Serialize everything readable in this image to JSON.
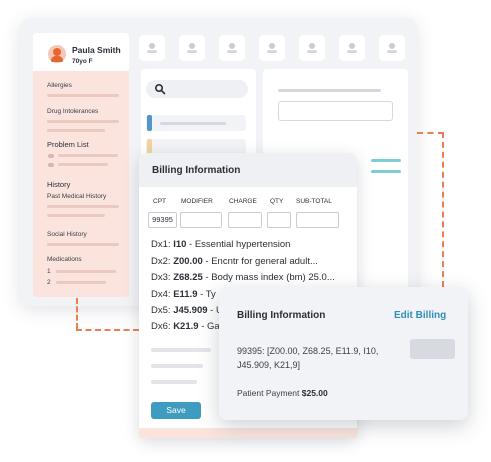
{
  "patient": {
    "name": "Paula Smith",
    "meta": "70yo F"
  },
  "sidebar": {
    "sections": [
      "Allergies",
      "Drug Intolerances",
      "Problem List",
      "History",
      "Past Medical History",
      "Social History",
      "Medications"
    ],
    "medication_numbers": [
      "1",
      "2"
    ]
  },
  "billing_form": {
    "title": "Billing Information",
    "columns": [
      "CPT",
      "MODIFIER",
      "CHARGE",
      "QTY",
      "SUB-TOTAL"
    ],
    "cpt_value": "99395",
    "diagnoses": [
      {
        "prefix": "Dx1:",
        "code": "I10",
        "desc": "- Essential hypertension"
      },
      {
        "prefix": "Dx2:",
        "code": "Z00.00",
        "desc": "- Encntr for general adult..."
      },
      {
        "prefix": "Dx3:",
        "code": "Z68.25",
        "desc": "- Body mass index (bm) 25.0..."
      },
      {
        "prefix": "Dx4:",
        "code": "E11.9",
        "desc": "- Ty"
      },
      {
        "prefix": "Dx5:",
        "code": "J45.909",
        "desc": "- Un"
      },
      {
        "prefix": "Dx6:",
        "code": "K21.9",
        "desc": "- Ga"
      }
    ],
    "save_label": "Save"
  },
  "summary": {
    "title": "Billing Information",
    "edit_label": "Edit Billing",
    "codes": "99395: [Z00.00, Z68.25, E11.9, I10, J45.909, K21,9]",
    "payment_label": "Patient Payment",
    "payment_amount": "$25.00"
  },
  "colors": {
    "accent": "#3f9bbf",
    "link": "#2f8fb7",
    "sidebar_bg": "#fbe4dd",
    "connector": "#ef7d52"
  },
  "icons": [
    "search-icon",
    "user-avatar-icon"
  ]
}
